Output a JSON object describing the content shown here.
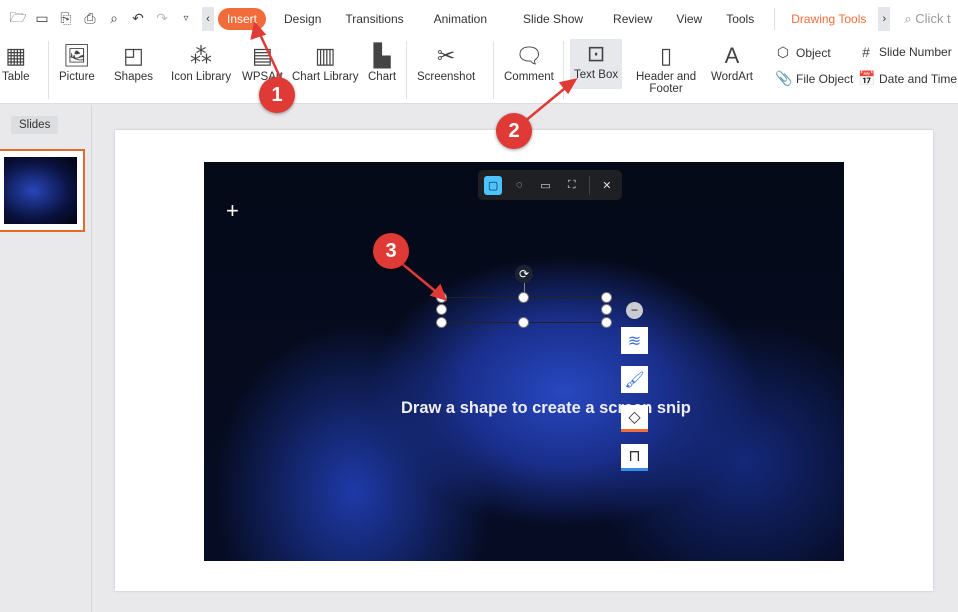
{
  "quick_access": {
    "icons": [
      "open-folder-icon",
      "save-icon",
      "export-pdf-icon",
      "print-icon",
      "print-preview-icon",
      "undo-icon",
      "redo-icon",
      "customize-icon"
    ]
  },
  "tabs": [
    {
      "label": "Insert",
      "active": true
    },
    {
      "label": "Design"
    },
    {
      "label": "Transitions"
    },
    {
      "label": "Animation"
    },
    {
      "label": "Slide Show"
    },
    {
      "label": "Review"
    },
    {
      "label": "View"
    },
    {
      "label": "Tools"
    }
  ],
  "contextual_tab": "Drawing Tools",
  "search_placeholder": "Click t",
  "ribbon": {
    "table": "Table",
    "picture": "Picture",
    "shapes": "Shapes",
    "icon_library": "Icon Library",
    "wpsart": "WPSArt",
    "chart_library": "Chart Library",
    "chart": "Chart",
    "screenshot": "Screenshot",
    "comment": "Comment",
    "text_box": "Text Box",
    "header_footer_1": "Header and",
    "header_footer_2": "Footer",
    "wordart": "WordArt",
    "object": "Object",
    "file_object": "File Object",
    "slide_number": "Slide Number",
    "date_time": "Date and Time"
  },
  "panel": {
    "slides_label": "Slides"
  },
  "slide": {
    "hint": "Draw a shape to create a screen snip"
  },
  "annotations": [
    "1",
    "2",
    "3"
  ],
  "colors": {
    "accent": "#f26b3a",
    "badge": "#e03a36",
    "snip_active": "#4cc2ff"
  }
}
